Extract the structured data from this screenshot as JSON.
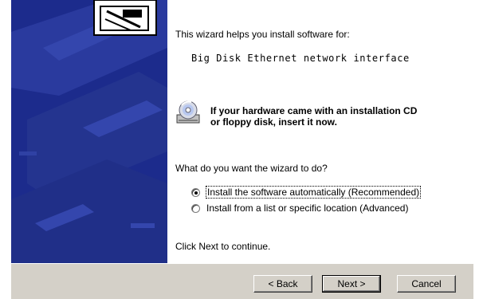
{
  "wizard": {
    "intro_text": "This wizard helps you install software for:",
    "device_name": "Big Disk Ethernet network interface",
    "cd_prompt_line1": "If your hardware came with an installation CD",
    "cd_prompt_line2": "or floppy disk, insert it now.",
    "question": "What do you want the wizard to do?",
    "options": [
      {
        "label": "Install the software automatically (Recommended)",
        "selected": true
      },
      {
        "label": "Install from a list or specific location (Advanced)",
        "selected": false
      }
    ],
    "continue_hint": "Click Next to continue."
  },
  "buttons": {
    "back_label": "< Back",
    "next_label": "Next >",
    "cancel_label": "Cancel"
  },
  "colors": {
    "left_panel": "#1c2b8c",
    "dialog_face": "#d4d0c8"
  },
  "icons": {
    "cd": "cd-drive-icon",
    "banner": "hardware-illustration"
  }
}
